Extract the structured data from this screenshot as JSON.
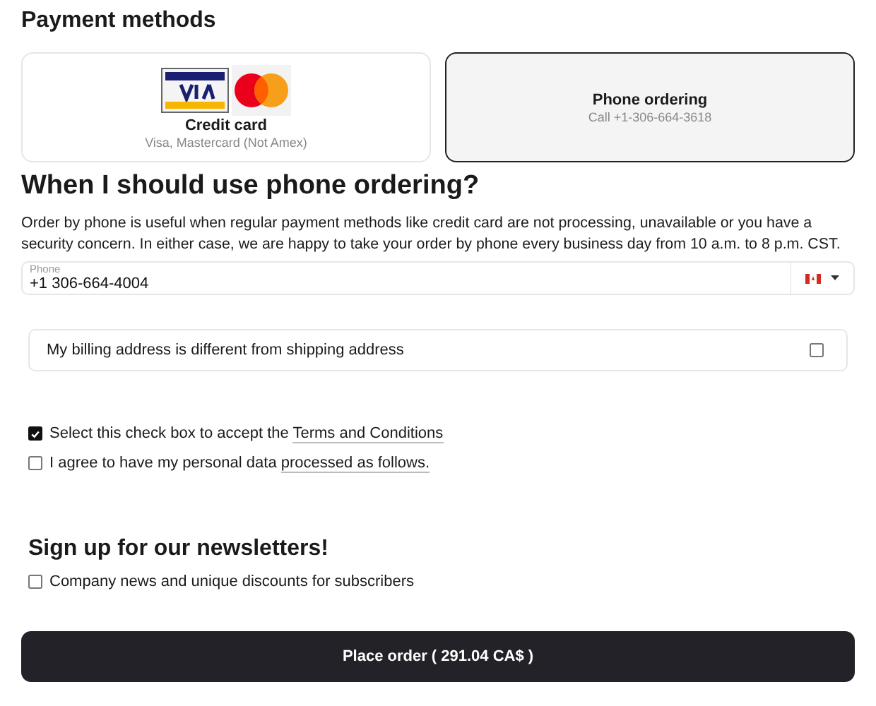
{
  "title": "Payment methods",
  "methods": [
    {
      "kind": "cards",
      "label": "Credit card",
      "note": "Visa, Mastercard (Not Amex)",
      "selected": false
    },
    {
      "kind": "phone",
      "label": "Phone ordering",
      "note": "Call +1-306-664-3618",
      "selected": true
    }
  ],
  "info": {
    "heading": "When I should use phone ordering?",
    "text": "Order by phone is useful when regular payment methods like credit card are not processing, unavailable or you have a security concern. In either case, we are happy to take your order by phone every business day from 10 a.m. to 8 p.m. CST."
  },
  "phone": {
    "label": "Phone",
    "value": "+1 306-664-4004"
  },
  "billing": {
    "label": "My billing address is different from shipping address",
    "checked": false
  },
  "consents": [
    {
      "text": "Select this check box to accept the",
      "link": "Terms and Conditions",
      "checked": true
    },
    {
      "text": "I agree to have my personal data",
      "link": "processed as follows.",
      "checked": false
    }
  ],
  "newsletter": {
    "heading": "Sign up for our newsletters!",
    "label": "Company news and unique discounts for subscribers",
    "checked": false
  },
  "submit": "Place order ( 291.04 CA$ )"
}
